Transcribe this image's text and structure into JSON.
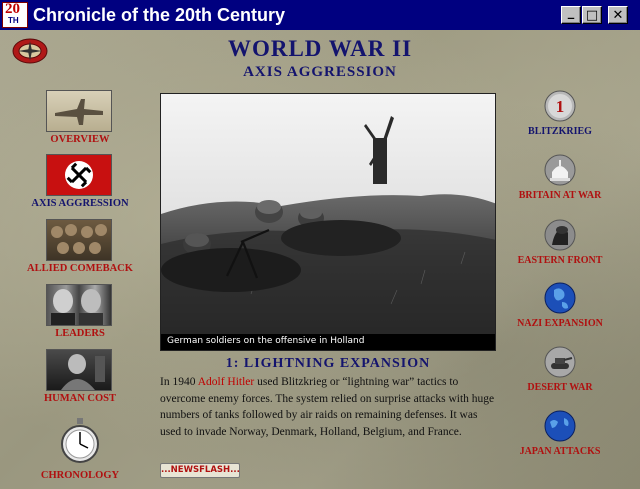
{
  "window": {
    "title": "Chronicle of the 20th Century",
    "icon_number": "20",
    "icon_suffix": "TH",
    "minimize": "_",
    "maximize": "□",
    "close": "✕"
  },
  "header": {
    "title": "WORLD WAR II",
    "subtitle": "AXIS AGGRESSION"
  },
  "left_nav": [
    {
      "label": "OVERVIEW",
      "icon": "plane-thumb-icon",
      "active": false
    },
    {
      "label": "AXIS AGGRESSION",
      "icon": "swastika-flag-icon",
      "active": true
    },
    {
      "label": "ALLIED COMEBACK",
      "icon": "soldiers-thumb-icon",
      "active": false
    },
    {
      "label": "LEADERS",
      "icon": "leaders-thumb-icon",
      "active": false
    },
    {
      "label": "HUMAN COST",
      "icon": "human-cost-thumb-icon",
      "active": false
    },
    {
      "label": "CHRONOLOGY",
      "icon": "stopwatch-icon",
      "active": false
    }
  ],
  "right_nav": [
    {
      "label": "BLITZKRIEG",
      "badge": "1",
      "icon": "number-badge-icon",
      "active": true
    },
    {
      "label": "BRITAIN AT WAR",
      "icon": "capitol-dome-icon",
      "active": false
    },
    {
      "label": "EASTERN FRONT",
      "icon": "soldier-silhouette-icon",
      "active": false
    },
    {
      "label": "NAZI EXPANSION",
      "icon": "globe-icon",
      "active": false
    },
    {
      "label": "DESERT WAR",
      "icon": "tank-icon",
      "active": false
    },
    {
      "label": "JAPAN ATTACKS",
      "icon": "globe-pacific-icon",
      "active": false
    }
  ],
  "photo": {
    "caption": "German soldiers on the offensive in Holland"
  },
  "article": {
    "heading": "1: LIGHTNING EXPANSION",
    "text_before": "In 1940 ",
    "link": "Adolf Hitler",
    "text_after": " used Blitzkrieg or “lightning war” tactics to overcome enemy forces.  The system relied on surprise attacks with huge numbers of tanks followed by air raids on remaining defenses.  It was used to invade Norway, Denmark, Holland, Belgium, and France."
  },
  "newsflash": {
    "label": "...NEWSFLASH..."
  },
  "colors": {
    "title_bar": "#000080",
    "heading_blue": "#14146e",
    "label_red": "#b01010"
  }
}
